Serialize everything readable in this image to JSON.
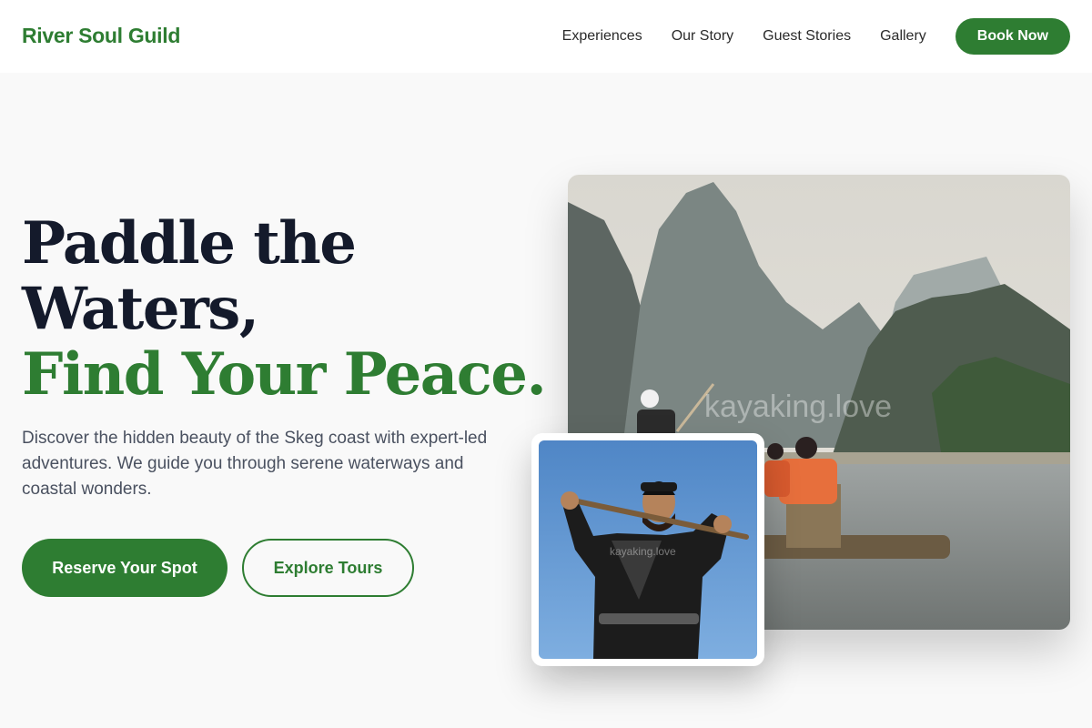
{
  "brand": {
    "name": "River Soul Guild"
  },
  "nav": {
    "items": [
      "Experiences",
      "Our Story",
      "Guest Stories",
      "Gallery"
    ],
    "cta_label": "Book Now"
  },
  "hero": {
    "title_line1": "Paddle the",
    "title_line2": "Waters,",
    "title_accent": "Find Your Peace.",
    "description": "Discover the hidden beauty of the Skeg coast with expert-led adventures. We guide you through serene waterways and coastal wonders.",
    "primary_cta": "Reserve Your Spot",
    "secondary_cta": "Explore Tours"
  },
  "images": {
    "main_watermark": "kayaking.love",
    "inset_watermark": "kayaking.love"
  },
  "colors": {
    "accent": "#2e7d32",
    "heading": "#141a2b",
    "body_text": "#4a5160",
    "background": "#f9f9f9"
  }
}
